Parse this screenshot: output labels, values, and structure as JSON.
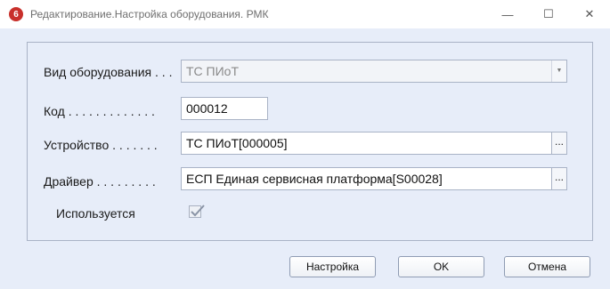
{
  "window": {
    "title": "Редактирование.Настройка оборудования. РМК",
    "icon_letter": "6",
    "min_glyph": "—",
    "max_glyph": "☐",
    "close_glyph": "✕"
  },
  "form": {
    "equipment_type": {
      "label": "Вид оборудования . . .",
      "value": "ТС ПИоТ",
      "icon": "chevron-down-icon"
    },
    "code": {
      "label": "Код . . . . . . . . . . . . .",
      "value": "000012"
    },
    "device": {
      "label": "Устройство . . . . . . .",
      "value": "ТС ПИоТ[000005]",
      "select_label": "..."
    },
    "driver": {
      "label": "Драйвер . . . . . . . . .",
      "value": "ЕСП Единая сервисная платформа[S00028]",
      "select_label": "..."
    },
    "in_use": {
      "label": "Используется",
      "checked": true,
      "icon": "checkmark-icon"
    }
  },
  "buttons": {
    "settings": "Настройка",
    "ok": "OK",
    "cancel": "Отмена"
  }
}
